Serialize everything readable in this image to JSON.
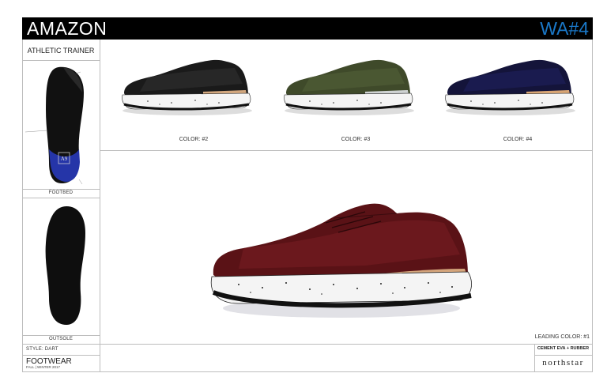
{
  "header": {
    "brand": "AMAZON",
    "code": "WA#4"
  },
  "sidebar": {
    "title": "ATHLETIC TRAINER",
    "footbed_label": "FOOTBED",
    "outsole_label": "OUTSOLE",
    "style": "STYLE: DART",
    "category": "FOOTWEAR",
    "season": "FALL | WINTER 2017",
    "insole_logo": "A9"
  },
  "colorways": [
    {
      "label": "COLOR: #2",
      "upper": "#1a1a1a",
      "knit": "#2b2b2b",
      "heel": "#d2a77e"
    },
    {
      "label": "COLOR: #3",
      "upper": "#3f4a2a",
      "knit": "#4d5a34",
      "heel": "#cfd3d3"
    },
    {
      "label": "COLOR: #4",
      "upper": "#14143a",
      "knit": "#1c1d55",
      "heel": "#d8a574"
    }
  ],
  "leading": {
    "label": "LEADING COLOR: #1",
    "upper": "#5a1216",
    "knit": "#6e1a1f",
    "heel": "#d4a57c"
  },
  "footer": {
    "material": "CEMENT EVA + RUBBER",
    "logo": "northstar"
  },
  "colors": {
    "accent": "#1a78c8",
    "footbed_blue": "#2535a8",
    "sole_white": "#f4f4f4",
    "speckle": "#222222"
  }
}
